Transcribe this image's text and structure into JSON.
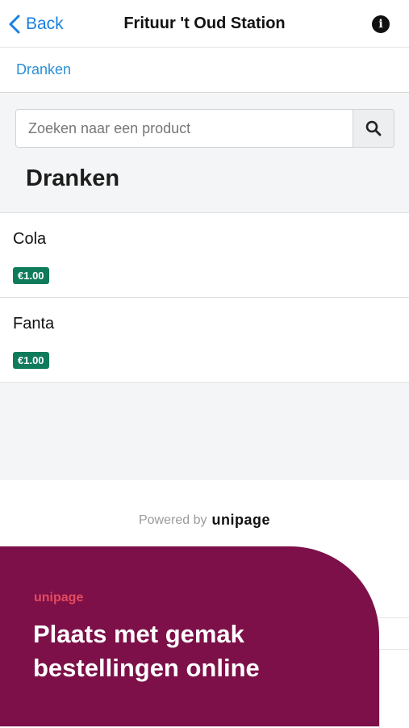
{
  "nav": {
    "back_label": "Back",
    "title": "Frituur 't Oud Station",
    "info_icon": "info-icon"
  },
  "breadcrumb": {
    "label": "Dranken"
  },
  "search": {
    "placeholder": "Zoeken naar een product",
    "value": ""
  },
  "category": {
    "title": "Dranken"
  },
  "products": [
    {
      "name": "Cola",
      "price": "€1.00"
    },
    {
      "name": "Fanta",
      "price": "€1.00"
    }
  ],
  "footer": {
    "powered_by": "Powered by",
    "brand": "unipage"
  },
  "promo": {
    "logo": "unipage",
    "text": "Plaats met gemak bestellingen online"
  },
  "colors": {
    "accent": "#1a7fe0",
    "price_badge": "#0f7b5a",
    "promo_bg": "#7d1049",
    "promo_logo": "#e54b5e"
  }
}
